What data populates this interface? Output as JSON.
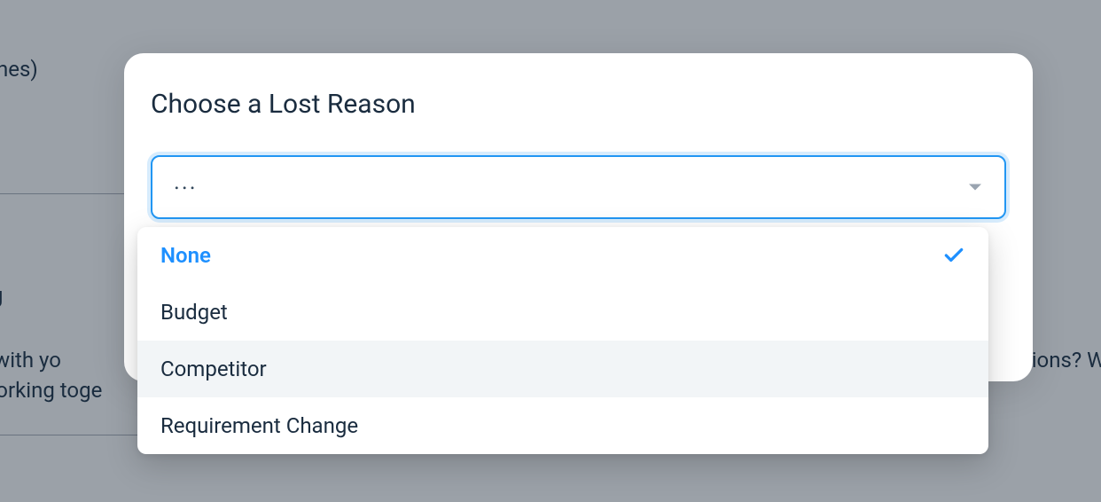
{
  "background": {
    "frag1": "Haines)",
    "frag2": "g",
    "frag3": "k in with yo",
    "frag3_right": "ions? We'r",
    "frag4": "to working toge"
  },
  "modal": {
    "title": "Choose a Lost Reason",
    "select": {
      "placeholder": "..."
    }
  },
  "dropdown": {
    "options": [
      {
        "label": "None",
        "selected": true,
        "hovered": false
      },
      {
        "label": "Budget",
        "selected": false,
        "hovered": false
      },
      {
        "label": "Competitor",
        "selected": false,
        "hovered": true
      },
      {
        "label": "Requirement Change",
        "selected": false,
        "hovered": false
      }
    ]
  },
  "colors": {
    "accent": "#1e90ff",
    "border_focus": "#2196f3",
    "text_primary": "#1a2c3f",
    "backdrop": "#9ba1a8"
  }
}
